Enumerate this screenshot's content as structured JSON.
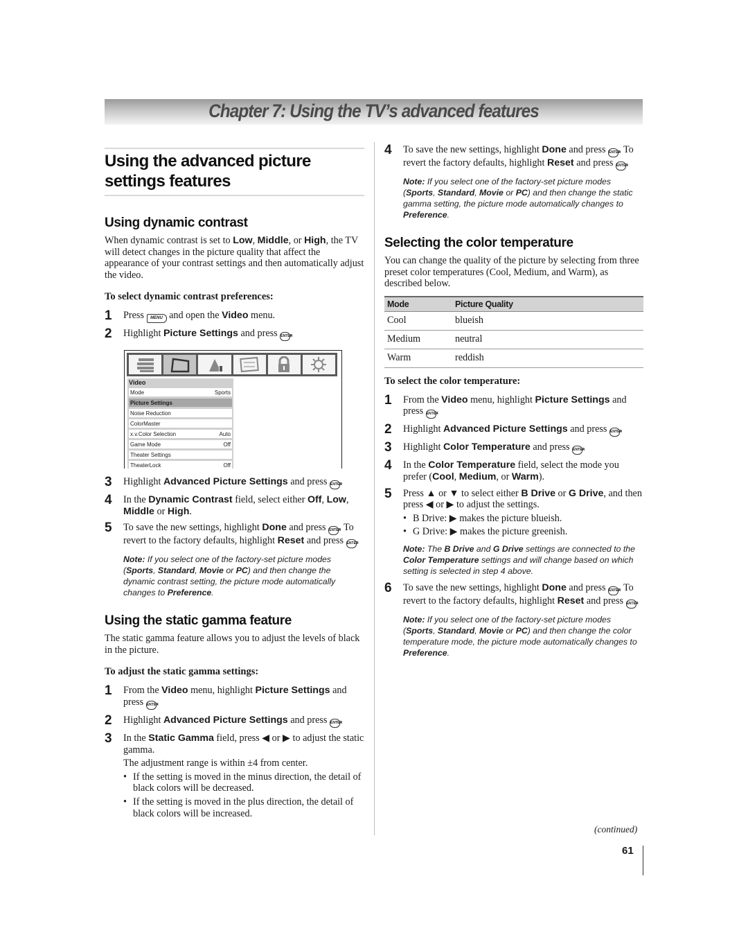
{
  "chapter": {
    "title": "Chapter 7: Using the TV’s advanced features"
  },
  "section": {
    "title": "Using the advanced picture settings features"
  },
  "dynamic_contrast": {
    "heading": "Using dynamic contrast",
    "intro": {
      "p1": "When dynamic contrast is set to ",
      "low": "Low",
      "c1": ", ",
      "middle": "Middle",
      "c2": ", or ",
      "high": "High",
      "p2": ", the TV will detect changes in the picture quality that affect the appearance of your contrast settings and then automatically adjust the video."
    },
    "subheading": "To select dynamic contrast preferences:",
    "steps": [
      {
        "num": "1",
        "a": "Press ",
        "key": "MENU",
        "b": " and open the ",
        "bold": "Video",
        "c": " menu."
      },
      {
        "num": "2",
        "a": "Highlight ",
        "bold": "Picture Settings",
        "b": " and press ",
        "key": "ENTER",
        "c": "."
      },
      {
        "num": "3",
        "a": "Highlight ",
        "bold": "Advanced Picture Settings",
        "b": " and press ",
        "key": "ENTER",
        "c": "."
      },
      {
        "num": "4",
        "a": "In the ",
        "bold": "Dynamic Contrast",
        "b": " field, select either ",
        "o1": "Off",
        "s1": ", ",
        "o2": "Low",
        "s2": ", ",
        "o3": "Middle",
        "s3": " or ",
        "o4": "High",
        "c": "."
      },
      {
        "num": "5",
        "a": "To save the new settings, highlight ",
        "bold": "Done",
        "b": " and press ",
        "key": "ENTER",
        "c": ". To revert to the factory defaults, highlight ",
        "bold2": "Reset",
        "d": " and press ",
        "e": "."
      }
    ],
    "note": {
      "label": "Note:",
      "a": " If you select one of the factory-set picture modes (",
      "m1": "Sports",
      "s1": ", ",
      "m2": "Standard",
      "s2": ", ",
      "m3": "Movie",
      "s3": " or ",
      "m4": "PC",
      "b": ") and then change the dynamic contrast setting, the picture mode automatically changes to ",
      "pref": "Preference",
      "c": "."
    }
  },
  "tv_menu": {
    "tabs": [
      "settings-icon",
      "video-icon",
      "audio-icon",
      "preferences-icon",
      "lock-icon",
      "setup-icon"
    ],
    "active_tab": 1,
    "panel_title": "Video",
    "rows": [
      {
        "label": "Mode",
        "value": "Sports"
      },
      {
        "label": "Picture Settings",
        "value": ""
      },
      {
        "label": "Noise Reduction",
        "value": ""
      },
      {
        "label": "ColorMaster",
        "value": ""
      },
      {
        "label": "x.v.Color Selection",
        "value": "Auto"
      },
      {
        "label": "Game Mode",
        "value": "Off"
      },
      {
        "label": "Theater Settings",
        "value": ""
      },
      {
        "label": "TheaterLock",
        "value": "Off"
      }
    ],
    "selected_row": 1
  },
  "static_gamma": {
    "heading": "Using the static gamma feature",
    "intro": "The static gamma feature allows you to adjust the levels of black in the picture.",
    "subheading": "To adjust the static gamma settings:",
    "steps": [
      {
        "num": "1",
        "a": "From the ",
        "bold": "Video",
        "b": " menu, highlight ",
        "bold2": "Picture Settings",
        "c": " and press ",
        "key": "ENTER",
        "d": "."
      },
      {
        "num": "2",
        "a": "Highlight ",
        "bold": "Advanced Picture Settings",
        "b": " and press ",
        "key": "ENTER",
        "c": "."
      },
      {
        "num": "3",
        "a": "In the ",
        "bold": "Static Gamma",
        "b": " field, press ◀ or ▶ to adjust the static gamma.",
        "range": "The adjustment range is within ±4 from center."
      }
    ],
    "bullets": [
      "If the setting is moved in the minus direction, the detail of black colors will be decreased.",
      "If the setting is moved in the plus direction, the detail of black colors will be increased."
    ],
    "step4": {
      "num": "4",
      "a": "To save the new settings, highlight ",
      "bold": "Done",
      "b": " and press ",
      "key": "ENTER",
      "c": ". To revert the factory defaults, highlight ",
      "bold2": "Reset",
      "d": " and press ",
      "e": "."
    },
    "note": {
      "label": "Note:",
      "a": " If you select one of the factory-set picture modes (",
      "m1": "Sports",
      "s1": ", ",
      "m2": "Standard",
      "s2": ", ",
      "m3": "Movie",
      "s3": " or ",
      "m4": "PC",
      "b": ") and then change the static gamma setting, the picture mode automatically changes to ",
      "pref": "Preference",
      "c": "."
    }
  },
  "color_temp": {
    "heading": "Selecting the color temperature",
    "intro": "You can change the quality of the picture by selecting from three preset color temperatures (Cool, Medium, and Warm), as described below.",
    "table": {
      "headers": [
        "Mode",
        "Picture Quality"
      ],
      "rows": [
        [
          "Cool",
          "blueish"
        ],
        [
          "Medium",
          "neutral"
        ],
        [
          "Warm",
          "reddish"
        ]
      ]
    },
    "subheading": "To select the color temperature:",
    "steps": [
      {
        "num": "1",
        "a": "From the ",
        "bold": "Video",
        "b": " menu, highlight ",
        "bold2": "Picture Settings",
        "c": " and press ",
        "key": "ENTER",
        "d": "."
      },
      {
        "num": "2",
        "a": "Highlight ",
        "bold": "Advanced Picture Settings",
        "b": " and press ",
        "key": "ENTER",
        "c": "."
      },
      {
        "num": "3",
        "a": "Highlight ",
        "bold": "Color Temperature",
        "b": " and press ",
        "key": "ENTER",
        "c": "."
      },
      {
        "num": "4",
        "a": "In the ",
        "bold": "Color Temperature",
        "b": " field, select the mode you prefer (",
        "o1": "Cool",
        "s1": ", ",
        "o2": "Medium",
        "s2": ", or ",
        "o3": "Warm",
        "c": ")."
      },
      {
        "num": "5",
        "a": "Press ▲ or ▼ to select either ",
        "bold": "B Drive",
        "b": " or ",
        "bold2": "G Drive",
        "c": ", and then press ◀ or ▶ to adjust the settings."
      },
      {
        "num": "6",
        "a": "To save the new settings, highlight ",
        "bold": "Done",
        "b": " and press ",
        "key": "ENTER",
        "c": ". To revert to the factory defaults, highlight ",
        "bold2": "Reset",
        "d": " and press ",
        "e": "."
      }
    ],
    "bullets": [
      "B Drive:  ▶ makes the picture blueish.",
      "G Drive:  ▶ makes the picture greenish."
    ],
    "note1": {
      "label": "Note:",
      "a": " The ",
      "b1": "B Drive",
      "b": " and ",
      "b2": "G Drive",
      "c": " settings are connected to the ",
      "b3": "Color Temperature",
      "d": " settings and will change based on which setting is selected in step 4 above."
    },
    "note2": {
      "label": "Note:",
      "a": " If you select one of the factory-set picture modes (",
      "m1": "Sports",
      "s1": ", ",
      "m2": "Standard",
      "s2": ", ",
      "m3": "Movie",
      "s3": " or ",
      "m4": "PC",
      "b": ") and then change the color temperature mode, the picture mode automatically changes to ",
      "pref": "Preference",
      "c": "."
    }
  },
  "footer": {
    "continued": "(continued)",
    "page_number": "61"
  }
}
